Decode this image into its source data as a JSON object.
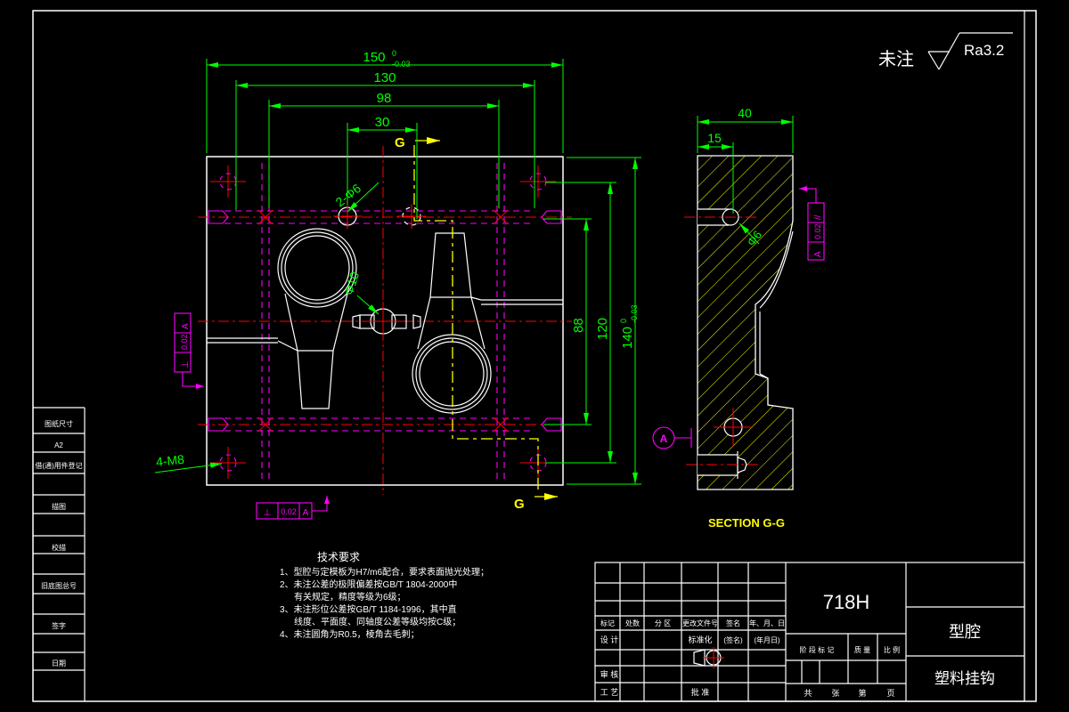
{
  "surface_note": {
    "prefix": "未注",
    "roughness": "Ra3.2"
  },
  "labels": {
    "g_top": "G",
    "g_bottom": "G",
    "section": "SECTION G-G",
    "datum_a": "A"
  },
  "dims": {
    "w150": "150",
    "w150_sup": "0",
    "w150_sub": "-0.03",
    "w130": "130",
    "w98": "98",
    "w30": "30",
    "h88": "88",
    "h120": "120",
    "h140": "140",
    "h140_sup": "0",
    "h140_sub": "-0.03",
    "s40": "40",
    "s15": "15",
    "hole_guide": "2-Φ6",
    "hole_sprue": "Φ10",
    "hole_corner": "4-M8",
    "hole_side": "Φ6"
  },
  "gdt": {
    "perp_sym": "⊥",
    "par_sym": "//",
    "tol": "0.02",
    "datum": "A"
  },
  "tech_req": {
    "title": "技术要求",
    "lines": [
      "1、型腔与定模板为H7/m6配合，要求表面抛光处理；",
      "2、未注公差的极限偏差按GB/T 1804-2000中",
      "有关规定，精度等级为6级；",
      "3、未注形位公差按GB/T 1184-1996，其中直",
      "线度、平面度、同轴度公差等级均按C级；",
      "4、未注圆角为R0.5，棱角去毛刺；"
    ]
  },
  "left_strip": {
    "items": [
      "图纸尺寸",
      "A2",
      "借(通)用件登记",
      "描图",
      "校描",
      "旧底图总号",
      "签字",
      "日期"
    ]
  },
  "title_block": {
    "material": "718H",
    "part_name": "型腔",
    "product_name": "塑料挂钩",
    "rev_headers": [
      "标记",
      "处数",
      "分 区",
      "更改文件号",
      "签名",
      "年、月、日"
    ],
    "design": "设 计",
    "standardize": "标准化",
    "sign_hint": "(签名)",
    "date_hint": "(年月日)",
    "check": "审 核",
    "process": "工 艺",
    "approve": "批 准",
    "stage_mark": "阶 段 标 记",
    "weight": "质 量",
    "scale": "比 例",
    "total": "共",
    "sheets": "张",
    "no": "第",
    "page": "页"
  },
  "colors": {
    "dim_green": "#00ff00",
    "hidden_magenta": "#ff00ff",
    "center_red": "#ff0000",
    "cut_yellow": "#ffff00",
    "outline_white": "#ffffff"
  }
}
